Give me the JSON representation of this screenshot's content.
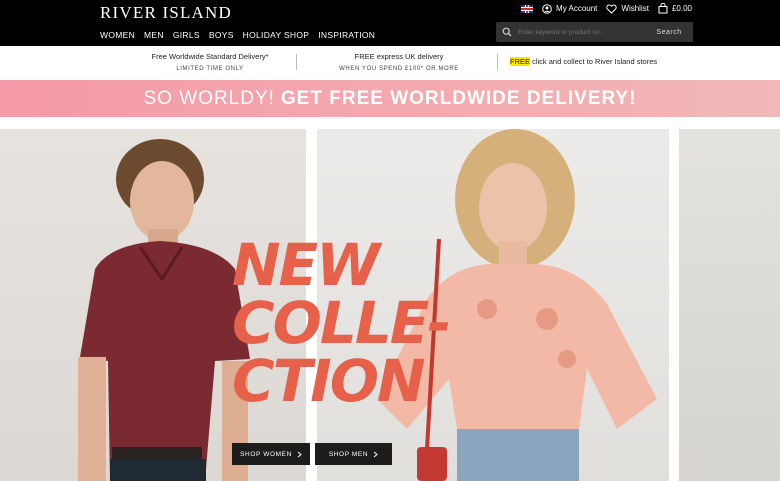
{
  "header": {
    "logo": "RIVER ISLAND",
    "nav": [
      "WOMEN",
      "MEN",
      "GIRLS",
      "BOYS",
      "HOLIDAY SHOP",
      "INSPIRATION"
    ],
    "account_label": "My Account",
    "wishlist_label": "Wishlist",
    "basket_total": "£0.00",
    "search": {
      "placeholder": "Enter keyword or product no.",
      "button": "Search"
    }
  },
  "delivery": {
    "col1_title": "Free Worldwide Standard Delivery*",
    "col1_sub": "LIMITED TIME ONLY",
    "col2_title": "FREE express UK delivery",
    "col2_sub": "WHEN YOU SPEND £100* OR MORE",
    "col3_highlight": "FREE",
    "col3_rest": " click and collect to River Island stores"
  },
  "promo": {
    "light": "SO WORLDY!",
    "bold": "GET FREE WORLDWIDE DELIVERY!"
  },
  "hero": {
    "headline_lines": [
      "NEW",
      "COLLE-",
      "CTION"
    ],
    "shop_women": "SHOP WOMEN",
    "shop_men": "SHOP MEN"
  },
  "colors": {
    "accent": "#e6604a",
    "banner": "#f3a8ae",
    "highlight": "#ffe600"
  }
}
